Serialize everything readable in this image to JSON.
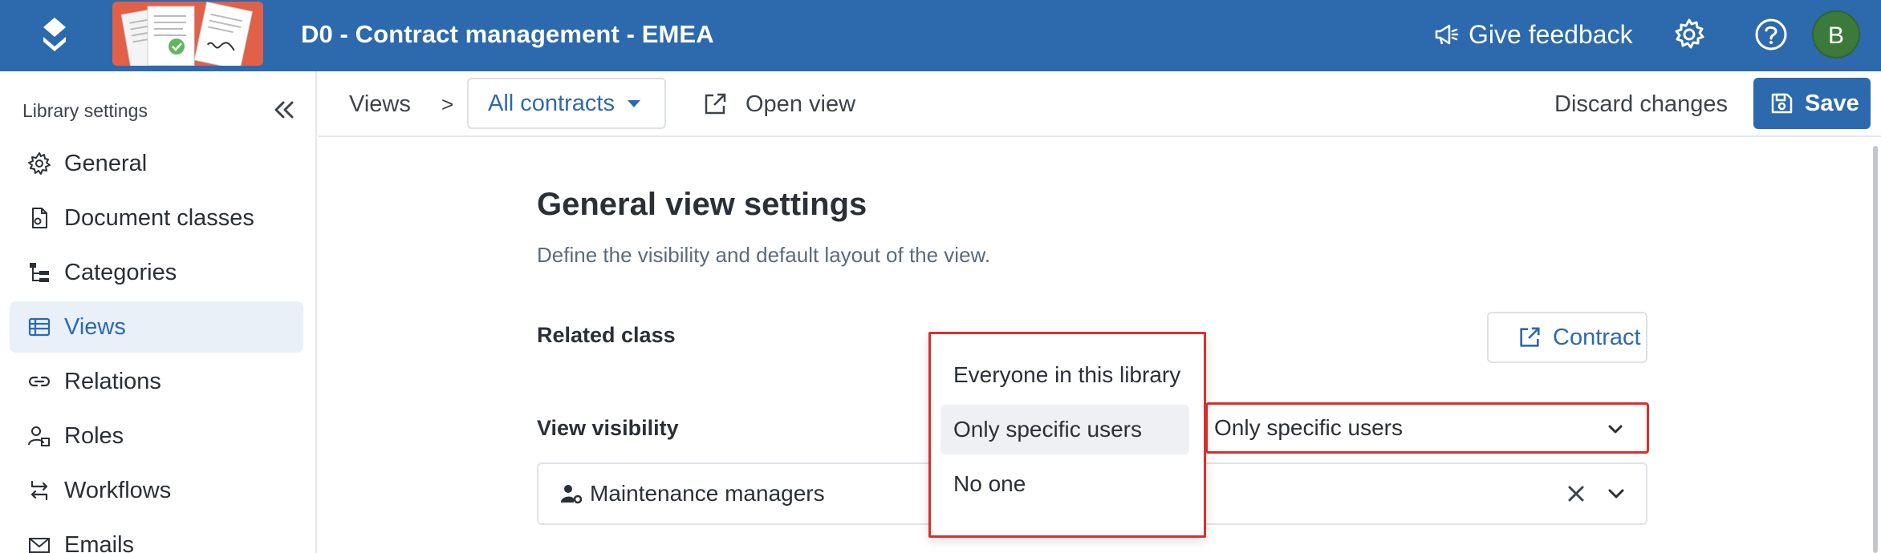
{
  "colors": {
    "brand": "#2d69ad",
    "highlight": "#d9302c",
    "active_bg": "#e9f0f8"
  },
  "topbar": {
    "library_title": "D0 - Contract management - EMEA",
    "feedback_label": "Give feedback",
    "avatar_initial": "B",
    "icons": [
      "app-logo-icon",
      "megaphone-icon",
      "settings-icon",
      "help-icon"
    ]
  },
  "sidebar": {
    "title": "Library settings",
    "items": [
      {
        "label": "General",
        "icon": "gear-icon",
        "active": false
      },
      {
        "label": "Document classes",
        "icon": "document-gear-icon",
        "active": false
      },
      {
        "label": "Categories",
        "icon": "hierarchy-icon",
        "active": false
      },
      {
        "label": "Views",
        "icon": "table-list-icon",
        "active": true
      },
      {
        "label": "Relations",
        "icon": "link-icon",
        "active": false
      },
      {
        "label": "Roles",
        "icon": "user-roles-icon",
        "active": false
      },
      {
        "label": "Workflows",
        "icon": "workflow-arrows-icon",
        "active": false
      },
      {
        "label": "Emails",
        "icon": "envelope-icon",
        "active": false
      }
    ]
  },
  "toolbar": {
    "breadcrumb_views": "Views",
    "breadcrumb_separator": ">",
    "current_view": "All contracts",
    "open_view_label": "Open view",
    "discard_label": "Discard changes",
    "save_label": "Save"
  },
  "main": {
    "heading": "General view settings",
    "subheading": "Define the visibility and default layout of the view.",
    "related_class_label": "Related class",
    "related_class_value": "Contract",
    "view_visibility_label": "View visibility",
    "view_visibility_value": "Only specific users",
    "selected_users": [
      "Maintenance managers"
    ]
  },
  "visibility_dropdown": {
    "options": [
      "Everyone in this library",
      "Only specific users",
      "No one"
    ],
    "selected": "Only specific users"
  }
}
